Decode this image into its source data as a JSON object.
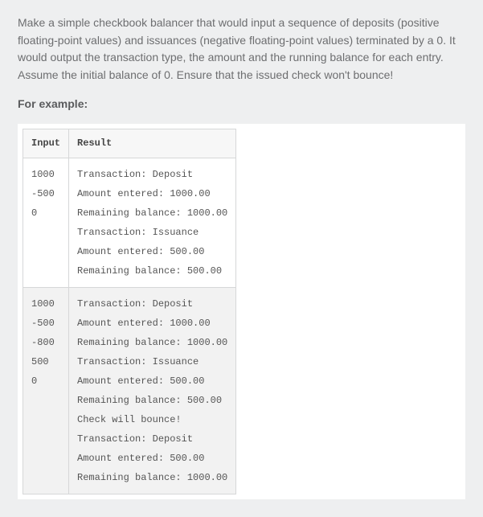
{
  "intro": "Make a simple checkbook balancer that would input a sequence of deposits (positive floating-point values) and issuances (negative floating-point values) terminated by a 0. It would output the transaction type, the amount and the running balance for each entry. Assume the initial balance of 0. Ensure that the issued check won't bounce!",
  "example_label": "For example:",
  "table": {
    "headers": {
      "input": "Input",
      "result": "Result"
    },
    "rows": [
      {
        "input": [
          "1000",
          "-500",
          "0"
        ],
        "result": [
          "Transaction: Deposit",
          "Amount entered: 1000.00",
          "Remaining balance: 1000.00",
          "Transaction: Issuance",
          "Amount entered: 500.00",
          "Remaining balance: 500.00"
        ]
      },
      {
        "input": [
          "1000",
          "-500",
          "-800",
          "500",
          "0"
        ],
        "result": [
          "Transaction: Deposit",
          "Amount entered: 1000.00",
          "Remaining balance: 1000.00",
          "Transaction: Issuance",
          "Amount entered: 500.00",
          "Remaining balance: 500.00",
          "Check will bounce!",
          "Transaction: Deposit",
          "Amount entered: 500.00",
          "Remaining balance: 1000.00"
        ]
      }
    ]
  }
}
